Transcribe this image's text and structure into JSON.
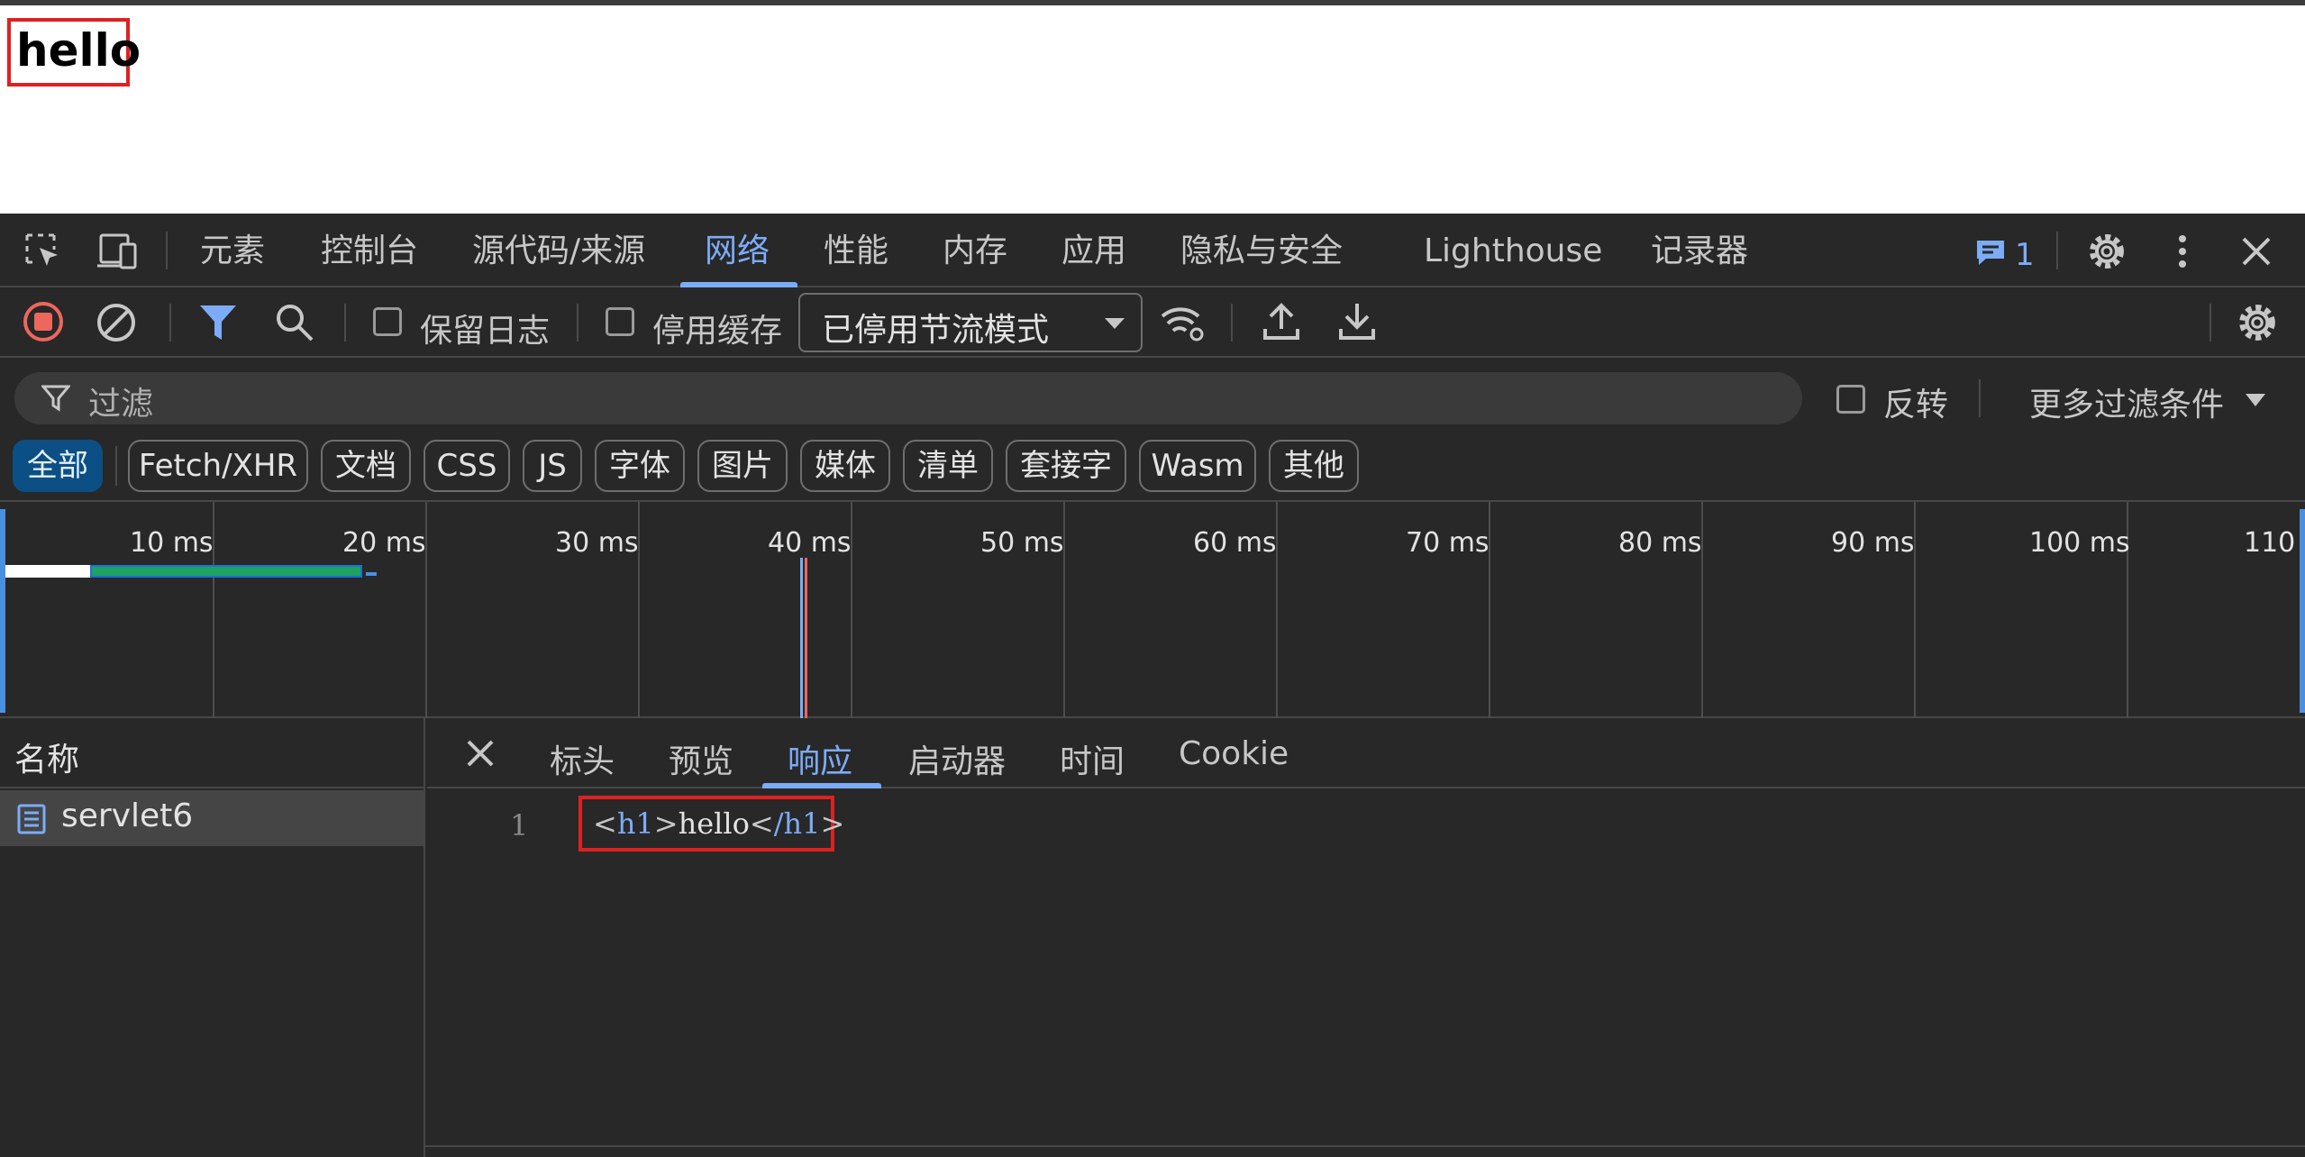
{
  "page": {
    "heading": "hello"
  },
  "devtools": {
    "panel_tabs": [
      {
        "label": "元素"
      },
      {
        "label": "控制台"
      },
      {
        "label": "源代码/来源"
      },
      {
        "label": "网络"
      },
      {
        "label": "性能"
      },
      {
        "label": "内存"
      },
      {
        "label": "应用"
      },
      {
        "label": "隐私与安全"
      },
      {
        "label": "Lighthouse"
      },
      {
        "label": "记录器"
      }
    ],
    "active_tab": "网络",
    "issues_count": "1",
    "accent_color": "#7cacf8",
    "toolbar": {
      "preserve_log": "保留日志",
      "disable_cache": "停用缓存",
      "throttling": "已停用节流模式"
    },
    "filter": {
      "placeholder": "过滤",
      "invert": "反转",
      "more_filters": "更多过滤条件"
    },
    "type_chips": [
      {
        "label": "全部"
      },
      {
        "label": "Fetch/XHR"
      },
      {
        "label": "文档"
      },
      {
        "label": "CSS"
      },
      {
        "label": "JS"
      },
      {
        "label": "字体"
      },
      {
        "label": "图片"
      },
      {
        "label": "媒体"
      },
      {
        "label": "清单"
      },
      {
        "label": "套接字"
      },
      {
        "label": "Wasm"
      },
      {
        "label": "其他"
      }
    ],
    "active_chip": "全部",
    "timeline_labels": [
      "10 ms",
      "20 ms",
      "30 ms",
      "40 ms",
      "50 ms",
      "60 ms",
      "70 ms",
      "80 ms",
      "90 ms",
      "100 ms",
      "110"
    ],
    "request_list": {
      "header": "名称",
      "rows": [
        {
          "name": "servlet6"
        }
      ]
    },
    "detail_tabs": [
      {
        "label": "标头"
      },
      {
        "label": "预览"
      },
      {
        "label": "响应"
      },
      {
        "label": "启动器"
      },
      {
        "label": "时间"
      },
      {
        "label": "Cookie"
      }
    ],
    "active_detail_tab": "响应",
    "response": {
      "line_number": "1",
      "open_tag": "h1",
      "content": "hello",
      "close_tag": "/h1"
    }
  }
}
